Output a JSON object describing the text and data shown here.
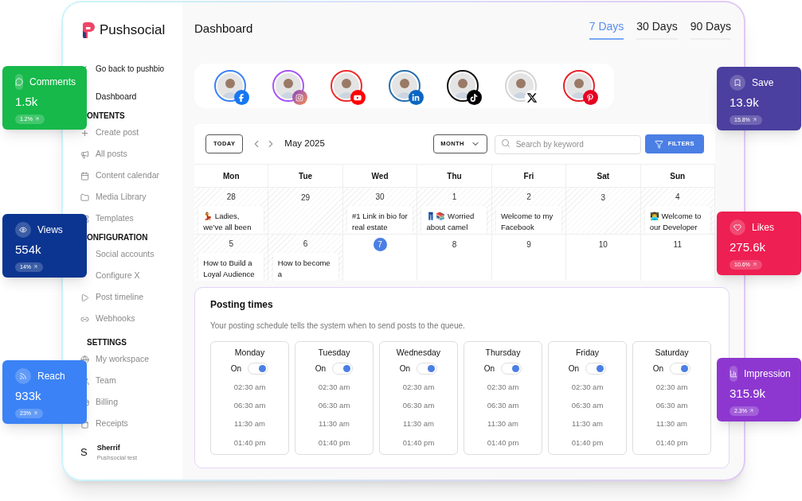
{
  "sidebar": {
    "brand": "Pushsocial",
    "back_link": "Go back to pushbio",
    "sections": [
      {
        "items": [
          {
            "label": "Dashboard",
            "selected": true
          }
        ]
      },
      {
        "heading": "ONTENTS",
        "items": [
          {
            "label": "Create post",
            "selected": false
          },
          {
            "label": "All posts",
            "selected": false
          },
          {
            "label": "Content calendar",
            "selected": false
          },
          {
            "label": "Media Library",
            "selected": false
          },
          {
            "label": "Templates",
            "selected": false
          }
        ]
      },
      {
        "heading": "ONFIGURATION",
        "items": [
          {
            "label": "Social accounts",
            "selected": false
          },
          {
            "label": "Configure X",
            "selected": false
          },
          {
            "label": "Post timeline",
            "selected": false
          },
          {
            "label": "Webhooks",
            "selected": false
          }
        ]
      },
      {
        "heading": "SETTINGS",
        "items": [
          {
            "label": "My workspace",
            "selected": false
          },
          {
            "label": "Team",
            "selected": false
          },
          {
            "label": "Billing",
            "selected": false
          },
          {
            "label": "Receipts",
            "selected": false
          }
        ]
      }
    ],
    "user": {
      "initial": "S",
      "name": "Sherrif",
      "workspace": "Pushsocial test"
    }
  },
  "header": {
    "title": "Dashboard",
    "ranges": [
      {
        "label": "7 Days",
        "selected": true
      },
      {
        "label": "30 Days",
        "selected": false
      },
      {
        "label": "90 Days",
        "selected": false
      }
    ]
  },
  "accounts": [
    {
      "kind": "facebook",
      "color": "#3b82f6"
    },
    {
      "kind": "instagram",
      "color": "#a855f7"
    },
    {
      "kind": "youtube",
      "color": "#ef2b2b"
    },
    {
      "kind": "linkedin",
      "color": "#2a6fae"
    },
    {
      "kind": "tiktok",
      "color": "#111111"
    },
    {
      "kind": "x",
      "color": "#d4d4d4"
    },
    {
      "kind": "pinterest",
      "color": "#e8202a"
    }
  ],
  "calendar": {
    "today_button": "TODAY",
    "month": "May 2025",
    "view": "MONTH",
    "search": {
      "placeholder": "Search by keyword"
    },
    "filters_button": "FILTERS",
    "weekdays": [
      "Mon",
      "Tue",
      "Wed",
      "Thu",
      "Fri",
      "Sat",
      "Sun"
    ],
    "weeks": [
      [
        {
          "day": "28",
          "past": true,
          "selected": false,
          "event": "💃 Ladies, we’ve all been"
        },
        {
          "day": "29",
          "past": true,
          "selected": false
        },
        {
          "day": "30",
          "past": true,
          "selected": false,
          "event": "#1 Link in bio for real estate"
        },
        {
          "day": "1",
          "past": true,
          "selected": false,
          "event": "👖📚 Worried about camel"
        },
        {
          "day": "2",
          "past": true,
          "selected": false,
          "event": "Welcome to my Facebook"
        },
        {
          "day": "3",
          "past": true,
          "selected": false
        },
        {
          "day": "4",
          "past": true,
          "selected": false,
          "event": "👨‍💻 Welcome to our Developer"
        }
      ],
      [
        {
          "day": "5",
          "past": true,
          "selected": false,
          "event": "How to Build a Loyal Audience"
        },
        {
          "day": "6",
          "past": true,
          "selected": false,
          "event": "How to become a"
        },
        {
          "day": "7",
          "past": false,
          "selected": true
        },
        {
          "day": "8",
          "past": false,
          "selected": false
        },
        {
          "day": "9",
          "past": false,
          "selected": false
        },
        {
          "day": "10",
          "past": false,
          "selected": false
        },
        {
          "day": "11",
          "past": false,
          "selected": false
        }
      ]
    ]
  },
  "posting_times": {
    "title": "Posting times",
    "description": "Your posting schedule tells the system when to send posts to the queue.",
    "days": [
      {
        "name": "Monday",
        "status": "On",
        "on": true,
        "times": [
          "02:30 am",
          "06:30 am",
          "11:30 am",
          "01:40 pm"
        ]
      },
      {
        "name": "Tuesday",
        "status": "On",
        "on": true,
        "times": [
          "02:30 am",
          "06:30 am",
          "11:30 am",
          "01:40 pm"
        ]
      },
      {
        "name": "Wednesday",
        "status": "On",
        "on": true,
        "times": [
          "02:30 am",
          "06:30 am",
          "11:30 am",
          "01:40 pm"
        ]
      },
      {
        "name": "Thursday",
        "status": "On",
        "on": true,
        "times": [
          "02:30 am",
          "06:30 am",
          "11:30 am",
          "01:40 pm"
        ]
      },
      {
        "name": "Friday",
        "status": "On",
        "on": true,
        "times": [
          "02:30 am",
          "06:30 am",
          "11:30 am",
          "01:40 pm"
        ]
      },
      {
        "name": "Saturday",
        "status": "On",
        "on": true,
        "times": [
          "02:30 am",
          "06:30 am",
          "11:30 am",
          "01:40 pm"
        ]
      }
    ]
  },
  "stats": [
    {
      "label": "Comments",
      "value": "1.5k",
      "change": "1.2%",
      "color": "#16b94a"
    },
    {
      "label": "Views",
      "value": "554k",
      "change": "14%",
      "color": "#0b3590"
    },
    {
      "label": "Reach",
      "value": "933k",
      "change": "23%",
      "color": "#3b82f6"
    },
    {
      "label": "Save",
      "value": "13.9k",
      "change": "15.8%",
      "color": "#4b3f9f"
    },
    {
      "label": "Likes",
      "value": "275.6k",
      "change": "10.6%",
      "color": "#ee1f52"
    },
    {
      "label": "Impression",
      "value": "315.9k",
      "change": "2.3%",
      "color": "#8d37d0"
    }
  ]
}
